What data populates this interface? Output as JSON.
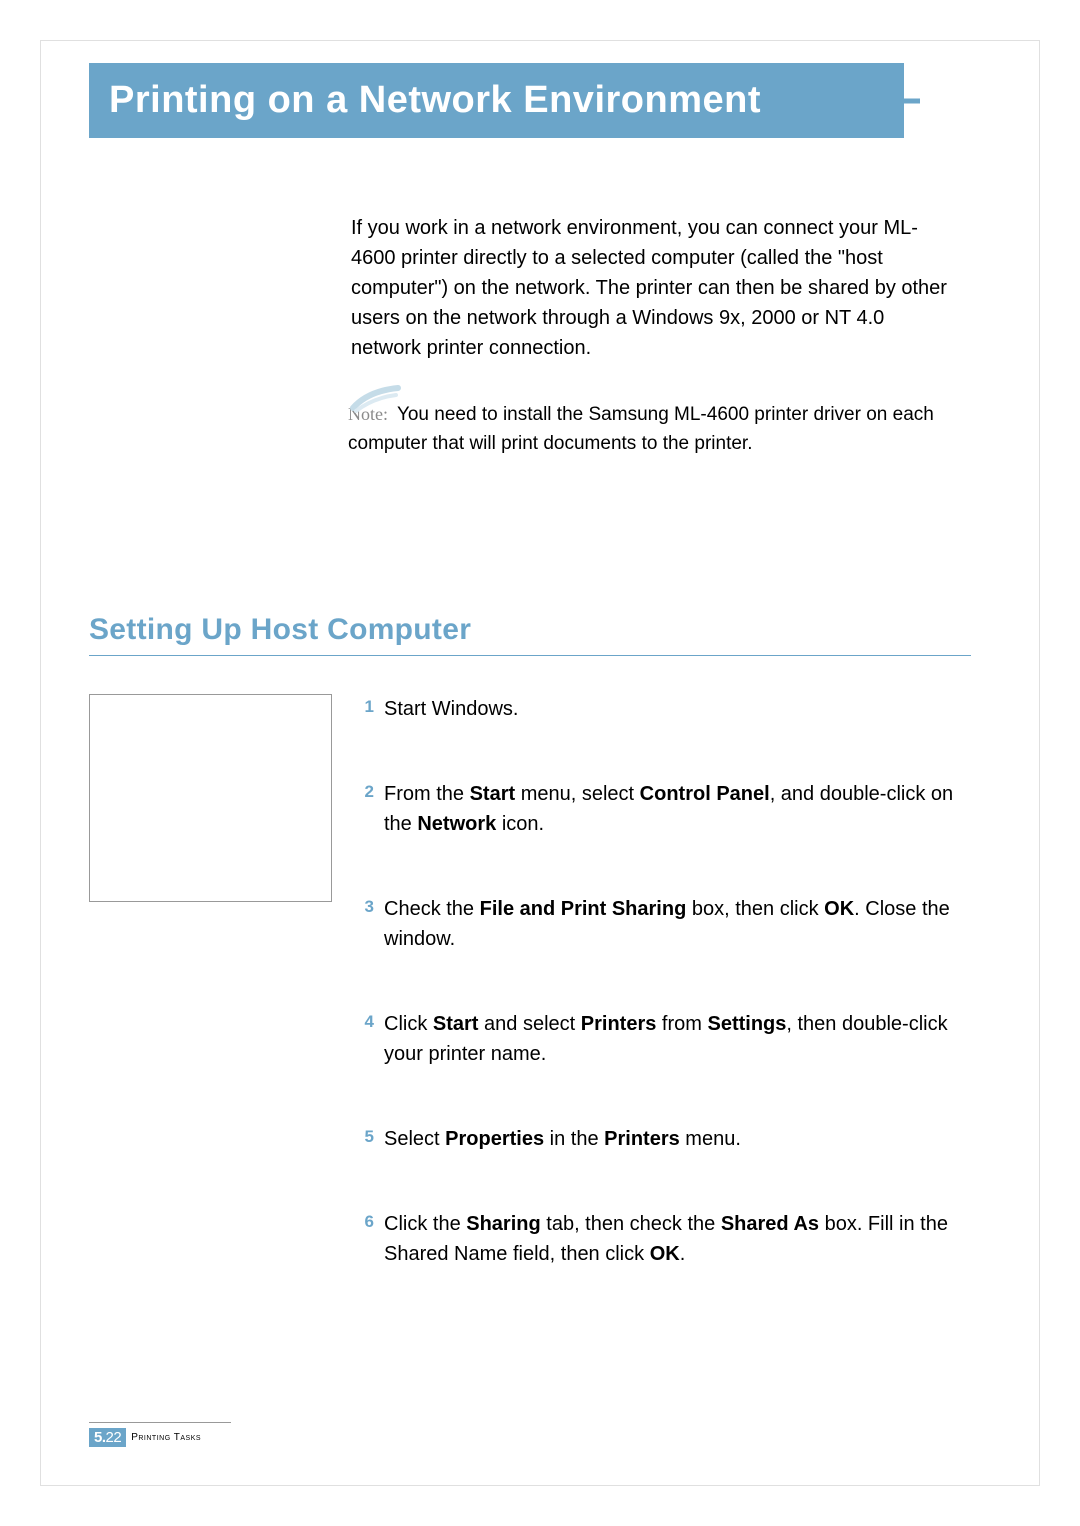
{
  "title": "Printing on a Network Environment",
  "intro": "If you work in a network environment, you can connect your ML-4600 printer directly to a selected computer (called the \"host computer\") on the network. The printer can then be shared  by other users on the network through a Windows 9x, 2000 or NT 4.0 network printer connection.",
  "note": {
    "label": "Note:",
    "text": "You need to install the Samsung ML-4600 printer driver on each computer that will print documents to the printer."
  },
  "section_heading": "Setting Up Host Computer",
  "steps": [
    {
      "num": "1",
      "html": "Start Windows."
    },
    {
      "num": "2",
      "html": "From the <b>Start</b> menu, select <b>Control Panel</b>, and double-click on the <b>Network</b> icon."
    },
    {
      "num": "3",
      "html": "Check the <b>File and Print Sharing</b> box, then click <b>OK</b>. Close the window."
    },
    {
      "num": "4",
      "html": "Click <b>Start</b> and select <b>Printers</b> from <b>Settings</b>, then double-click your printer name."
    },
    {
      "num": "5",
      "html": "Select <b>Properties</b> in the <b>Printers</b> menu."
    },
    {
      "num": "6",
      "html": "Click the <b>Sharing</b> tab, then check the <b>Shared As</b> box. Fill in the Shared Name field, then click <b>OK</b>."
    }
  ],
  "footer": {
    "chapter": "5.",
    "page": "22",
    "label": "Printing Tasks"
  }
}
